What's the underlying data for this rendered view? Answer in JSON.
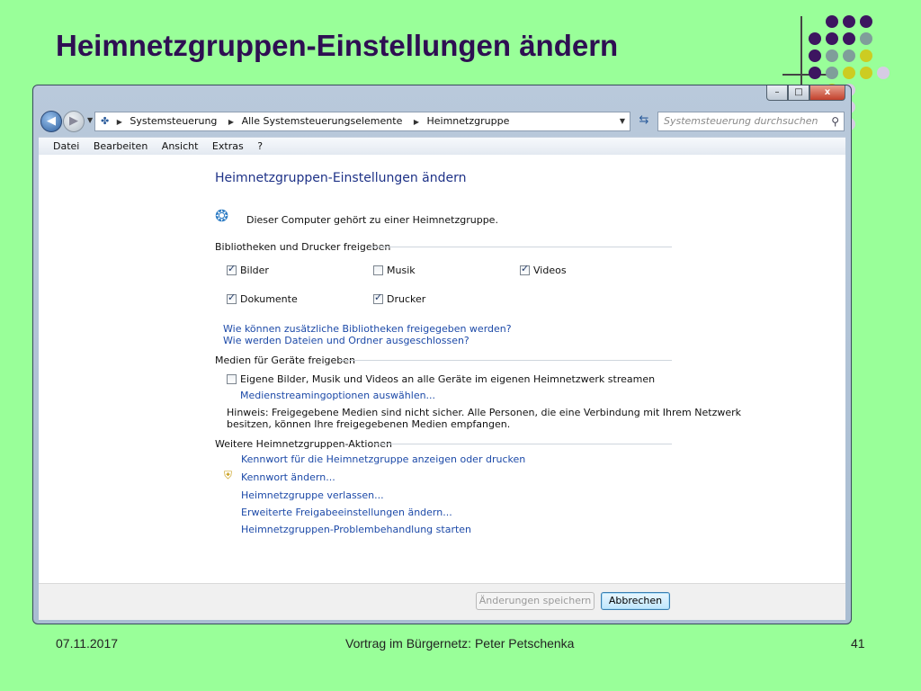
{
  "slide": {
    "title": "Heimnetzgruppen-Einstellungen ändern",
    "footer_date": "07.11.2017",
    "footer_center": "Vortrag im Bürgernetz: Peter Petschenka",
    "footer_page": "41"
  },
  "colors": {
    "slide_bg": "#99ff99",
    "title": "#2e0f52",
    "dot_purple": "#3d1560",
    "dot_teal": "#7f9e9a",
    "dot_yellow": "#cccc22",
    "dot_lavender": "#d6cce4",
    "link": "#1d4aa8",
    "heading": "#1e3287"
  },
  "window": {
    "controls": {
      "minimize": "–",
      "maximize": "□",
      "close": "x"
    },
    "nav": {
      "back_icon": "back-arrow-icon",
      "forward_icon": "forward-arrow-icon",
      "path": [
        "Systemsteuerung",
        "Alle Systemsteuerungselemente",
        "Heimnetzgruppe"
      ],
      "search_placeholder": "Systemsteuerung durchsuchen"
    },
    "menu": [
      "Datei",
      "Bearbeiten",
      "Ansicht",
      "Extras",
      "?"
    ]
  },
  "content": {
    "title": "Heimnetzgruppen-Einstellungen ändern",
    "membership_text": "Dieser Computer gehört zu einer Heimnetzgruppe.",
    "share_section": "Bibliotheken und Drucker freigeben",
    "shares": [
      {
        "label": "Bilder",
        "checked": true
      },
      {
        "label": "Musik",
        "checked": false
      },
      {
        "label": "Videos",
        "checked": true
      },
      {
        "label": "Dokumente",
        "checked": true
      },
      {
        "label": "Drucker",
        "checked": true
      }
    ],
    "link_libraries": "Wie können zusätzliche Bibliotheken freigegeben werden?",
    "link_excluded": "Wie werden Dateien und Ordner ausgeschlossen?",
    "media_section": "Medien für Geräte freigeben",
    "media_stream": {
      "label": "Eigene Bilder, Musik und Videos an alle Geräte im eigenen Heimnetzwerk streamen",
      "checked": false
    },
    "media_options_link": "Medienstreamingoptionen auswählen...",
    "hint_line1": "Hinweis: Freigegebene Medien sind nicht sicher. Alle Personen, die eine Verbindung mit Ihrem Netzwerk",
    "hint_line2": "besitzen, können Ihre freigegebenen Medien empfangen.",
    "actions_section": "Weitere Heimnetzgruppen-Aktionen",
    "actions": [
      "Kennwort für die Heimnetzgruppe anzeigen oder drucken",
      "Kennwort ändern...",
      "Heimnetzgruppe verlassen...",
      "Erweiterte Freigabeeinstellungen ändern...",
      "Heimnetzgruppen-Problembehandlung starten"
    ],
    "save_button": "Änderungen speichern",
    "cancel_button": "Abbrechen"
  }
}
